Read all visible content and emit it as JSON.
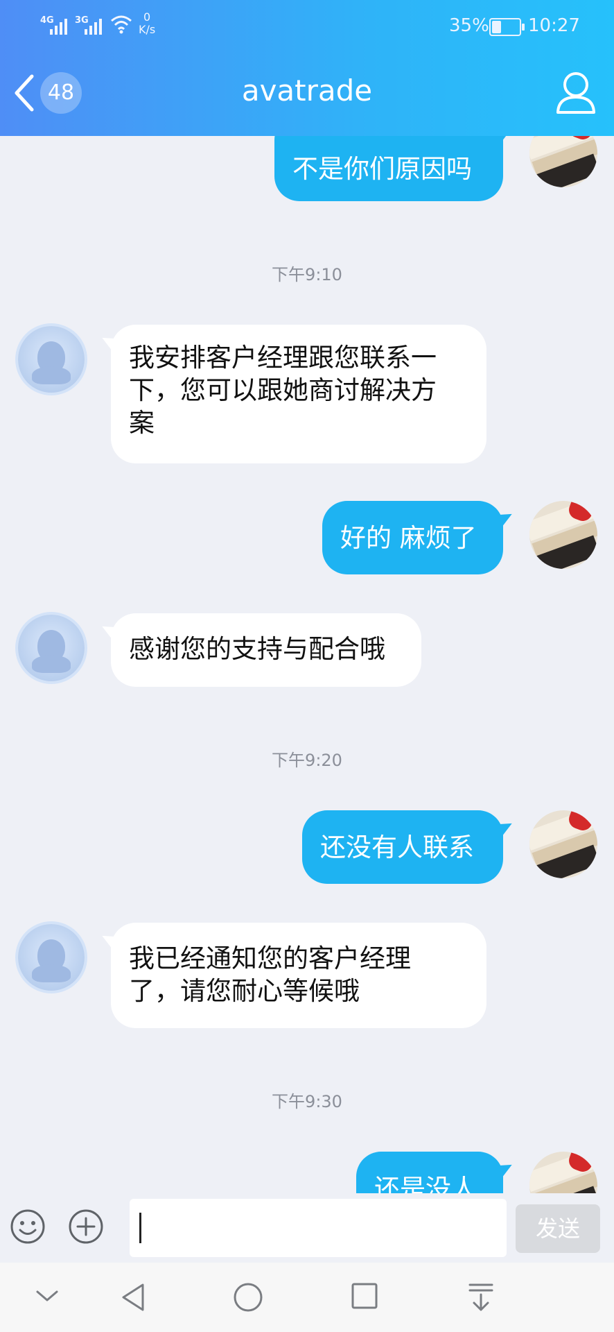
{
  "status_bar": {
    "sim1": "4G",
    "sim2": "3G",
    "net_speed_value": "0",
    "net_speed_unit": "K/s",
    "battery_percent": "35%",
    "battery_level": 0.35,
    "time": "10:27"
  },
  "header": {
    "unread_count": "48",
    "title": "avatrade",
    "icons": [
      "chevron-left-icon",
      "person-icon"
    ]
  },
  "messages": {
    "m1": "不是你们原因吗",
    "t1": "下午9:10",
    "m2_line1": "我安排客户经理跟您联系一",
    "m2_line2": "下，您可以跟她商讨解决方",
    "m2_line3": "案",
    "m3": "好的 麻烦了",
    "m4": "感谢您的支持与配合哦",
    "t2": "下午9:20",
    "m5": "还没有人联系",
    "m6_line1": "我已经通知您的客户经理",
    "m6_line2": "了，请您耐心等候哦",
    "t3": "下午9:30",
    "m7": "还是没人"
  },
  "input_bar": {
    "send_label": "发送",
    "icons": [
      "emoji-icon",
      "plus-icon"
    ]
  },
  "nav_bar": {
    "icons": [
      "chevron-down-icon",
      "back-triangle-icon",
      "home-circle-icon",
      "recents-square-icon",
      "pull-down-icon"
    ]
  },
  "colors": {
    "header_start": "#4f8ef6",
    "header_end": "#26c1fb",
    "outgoing_bubble": "#1eb3f2",
    "incoming_bubble": "#ffffff",
    "chat_background": "#eef0f6"
  }
}
